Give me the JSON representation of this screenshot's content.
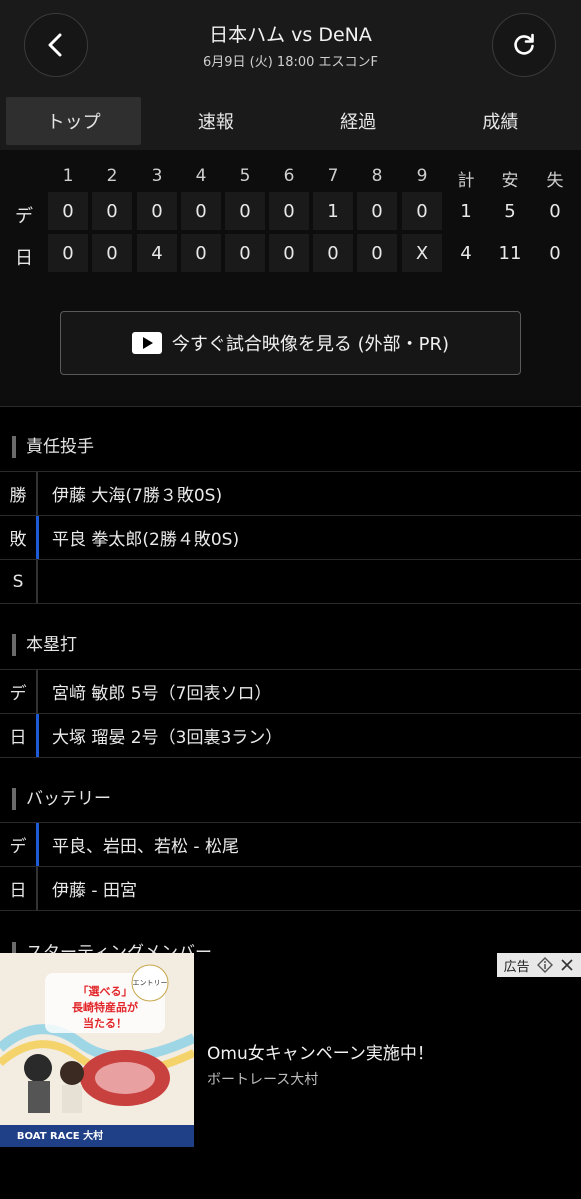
{
  "header": {
    "title": "日本ハム vs DeNA",
    "subtitle": "6月9日 (火) 18:00 エスコンF"
  },
  "tabs": [
    {
      "label": "トップ",
      "active": true
    },
    {
      "label": "速報",
      "active": false
    },
    {
      "label": "経過",
      "active": false
    },
    {
      "label": "成績",
      "active": false
    }
  ],
  "scoreboard": {
    "innings": [
      "1",
      "2",
      "3",
      "4",
      "5",
      "6",
      "7",
      "8",
      "9"
    ],
    "totals_headers": [
      "計",
      "安",
      "失"
    ],
    "rows": [
      {
        "team": "デ",
        "scores": [
          "0",
          "0",
          "0",
          "0",
          "0",
          "0",
          "1",
          "0",
          "0"
        ],
        "totals": [
          "1",
          "5",
          "0"
        ]
      },
      {
        "team": "日",
        "scores": [
          "0",
          "0",
          "4",
          "0",
          "0",
          "0",
          "0",
          "0",
          "X"
        ],
        "totals": [
          "4",
          "11",
          "0"
        ]
      }
    ]
  },
  "watch_button": {
    "label": "今すぐ試合映像を見る (外部・PR)",
    "icon": "play-icon"
  },
  "pitchers": {
    "title": "責任投手",
    "rows": [
      {
        "label": "勝",
        "value": "伊藤 大海(7勝３敗0S)"
      },
      {
        "label": "敗",
        "value": "平良 拳太郎(2勝４敗0S)"
      },
      {
        "label": "S",
        "value": ""
      }
    ]
  },
  "homeruns": {
    "title": "本塁打",
    "rows": [
      {
        "label": "デ",
        "value": "宮﨑 敏郎 5号（7回表ソロ）"
      },
      {
        "label": "日",
        "value": "大塚 瑠晏 2号（3回裏3ラン）"
      }
    ]
  },
  "battery": {
    "title": "バッテリー",
    "rows": [
      {
        "label": "デ",
        "value": "平良、岩田、若松 - 松尾"
      },
      {
        "label": "日",
        "value": "伊藤 - 田宮"
      }
    ]
  },
  "starting": {
    "title": "スターティングメンバー"
  },
  "ad": {
    "tag": "広告",
    "title": "Omu女キャンペーン実施中！",
    "advertiser": "ボートレース大村",
    "image_texts": {
      "headline": "「選べる」長崎特産品が当たる！",
      "entry": "エントリー抽選制",
      "logo": "BOAT RACE 大村"
    }
  }
}
